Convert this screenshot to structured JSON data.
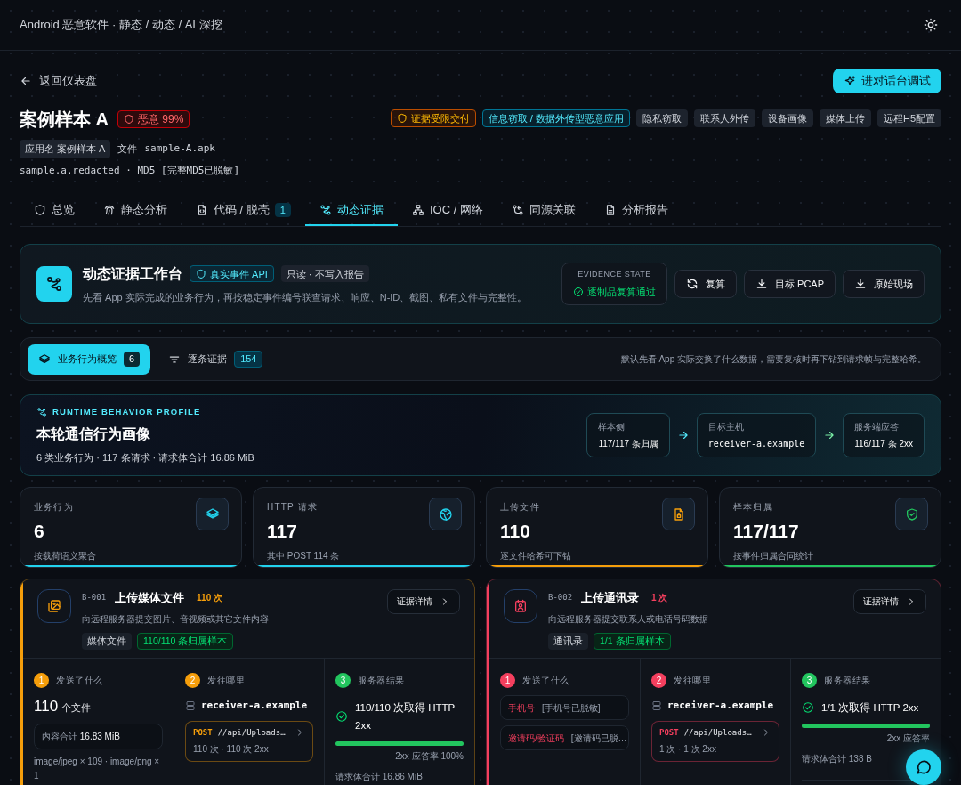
{
  "header": {
    "title": "Android 恶意软件 · 静态 / 动态 / AI 深挖"
  },
  "back_link": "返回仪表盘",
  "console_button": "进对话台调试",
  "sample": {
    "name": "案例样本 A",
    "verdict": "恶意 99%",
    "app_chip": "应用名 案例样本 A",
    "file_label": "文件",
    "file_name": "sample-A.apk",
    "hash_line": "sample.a.redacted · MD5 [完整MD5已脱敏]"
  },
  "tags": [
    {
      "label": "证据受限交付",
      "kind": "warn"
    },
    {
      "label": "信息窃取 / 数据外传型恶意应用",
      "kind": "primary"
    },
    {
      "label": "隐私窃取",
      "kind": "plain"
    },
    {
      "label": "联系人外传",
      "kind": "plain"
    },
    {
      "label": "设备画像",
      "kind": "plain"
    },
    {
      "label": "媒体上传",
      "kind": "plain"
    },
    {
      "label": "远程H5配置",
      "kind": "plain"
    }
  ],
  "tabs": [
    {
      "label": "总览",
      "selected": false
    },
    {
      "label": "静态分析",
      "selected": false
    },
    {
      "label": "代码 / 脱壳",
      "badge": "1",
      "selected": false
    },
    {
      "label": "动态证据",
      "selected": true
    },
    {
      "label": "IOC / 网络",
      "selected": false
    },
    {
      "label": "同源关联",
      "selected": false
    },
    {
      "label": "分析报告",
      "selected": false
    }
  ],
  "workbench": {
    "title": "动态证据工作台",
    "api_badge": "真实事件 API",
    "readonly_badge": "只读 · 不写入报告",
    "description": "先看 App 实际完成的业务行为，再按稳定事件编号联查请求、响应、N-ID、截图、私有文件与完整性。",
    "state_label": "EVIDENCE STATE",
    "state_value": "逐制品复算通过",
    "buttons": [
      "复算",
      "目标 PCAP",
      "原始现场"
    ]
  },
  "subtabs": [
    {
      "label": "业务行为概览",
      "count": "6",
      "selected": true
    },
    {
      "label": "逐条证据",
      "count": "154",
      "selected": false
    }
  ],
  "subtab_hint": "默认先看 App 实际交换了什么数据，需要复核时再下钻到请求帧与完整哈希。",
  "profile": {
    "eyebrow": "RUNTIME BEHAVIOR PROFILE",
    "title": "本轮通信行为画像",
    "summary": "6 类业务行为 · 117 条请求 · 请求体合计 16.86 MiB",
    "flow": [
      {
        "label": "样本侧",
        "value": "117/117 条归属",
        "mono": false
      },
      {
        "label": "目标主机",
        "value": "receiver-a.example",
        "mono": true
      },
      {
        "label": "服务端应答",
        "value": "116/117 条 2xx",
        "mono": false
      }
    ]
  },
  "stats": [
    {
      "label": "业务行为",
      "value": "6",
      "note": "按载荷语义聚合",
      "color": "#22d3ee"
    },
    {
      "label": "HTTP 请求",
      "value": "117",
      "note": "其中 POST 114 条",
      "color": "#22d3ee"
    },
    {
      "label": "上传文件",
      "value": "110",
      "note": "逐文件哈希可下钻",
      "color": "#f59e0b"
    },
    {
      "label": "样本归属",
      "value": "117/117",
      "note": "按事件归属合同统计",
      "color": "#22c55e"
    }
  ],
  "behaviors": [
    {
      "code": "B-001",
      "title": "上传媒体文件",
      "count": "110 次",
      "description": "向远程服务器提交图片、音视频或其它文件内容",
      "category": "媒体文件",
      "attribution": "110/110 条归属样本",
      "color": "#f59e0b",
      "details_button": "证据详情",
      "steps": [
        {
          "number": "1",
          "title": "发送了什么"
        },
        {
          "number": "2",
          "title": "发往哪里"
        },
        {
          "number": "3",
          "title": "服务器结果"
        }
      ],
      "what": {
        "kind": "files",
        "count": "110",
        "unit": "个文件",
        "total_label": "内容合计",
        "total_value": "16.83 MiB",
        "types": "image/jpeg × 109 · image/png × 1"
      },
      "host": "receiver-a.example",
      "endpoint": {
        "method": "POST",
        "path": "//api/Uploads…",
        "meta": "110 次 · 110 次 2xx"
      },
      "result": {
        "text": "110/110 次取得 HTTP 2xx",
        "level": 1,
        "rate": "2xx 应答率 100%",
        "body": "请求体合计 16.86 MiB"
      }
    },
    {
      "code": "B-002",
      "title": "上传通讯录",
      "count": "1 次",
      "description": "向远程服务器提交联系人或电话号码数据",
      "category": "通讯录",
      "attribution": "1/1 条归属样本",
      "color": "#f43f5e",
      "details_button": "证据详情",
      "steps": [
        {
          "number": "1",
          "title": "发送了什么"
        },
        {
          "number": "2",
          "title": "发往哪里"
        },
        {
          "number": "3",
          "title": "服务器结果"
        }
      ],
      "what": {
        "kind": "fields",
        "fields": [
          {
            "name": "手机号",
            "value": "[手机号已脱敏]"
          },
          {
            "name": "邀请码/验证码",
            "value": "[邀请码已脱…"
          }
        ]
      },
      "host": "receiver-a.example",
      "endpoint": {
        "method": "POST",
        "path": "//api/Uploads…",
        "meta": "1 次 · 1 次 2xx"
      },
      "result": {
        "text": "1/1 次取得 HTTP 2xx",
        "level": 1,
        "rate": "2xx 应答率",
        "body": "请求体合计 138 B"
      }
    }
  ]
}
